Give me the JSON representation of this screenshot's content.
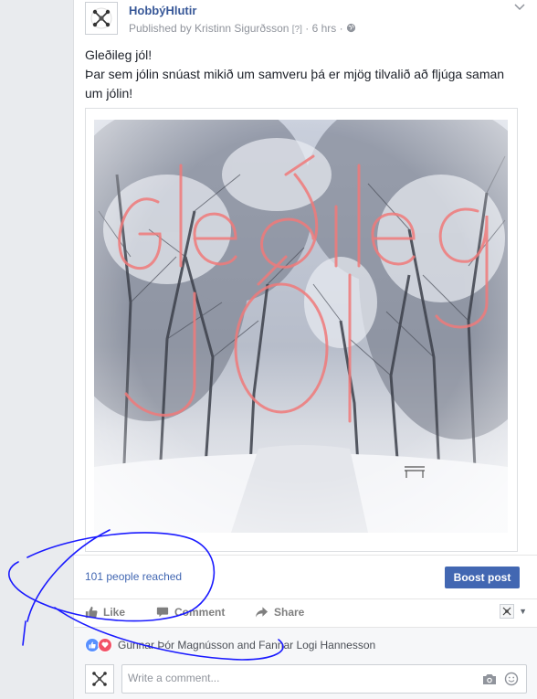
{
  "post": {
    "page_name": "HobbýHlutir",
    "published_by": "Published by Kristinn Sigurðsson",
    "help_mark": "[?]",
    "separator": "·",
    "time": "6 hrs",
    "separator2": "·",
    "text_lines": [
      "Gleðileg jól!",
      "Þar sem jólin snúast mikið um samveru þá er mjög tilvalið að fljúga saman",
      "um jólin!"
    ],
    "image_text": {
      "line1": "Gleðileg",
      "line2": "Jól"
    }
  },
  "stats": {
    "reach_count": "101",
    "reach_suffix": " people reached",
    "boost_label": "Boost post"
  },
  "actions": {
    "like": "Like",
    "comment": "Comment",
    "share": "Share"
  },
  "reactions": {
    "names": "Gunnar Þór Magnússon and Fannar Logi Hannesson"
  },
  "composer": {
    "placeholder": "Write a comment..."
  },
  "colors": {
    "link_blue": "#385898",
    "button_blue": "#4267b2",
    "annotation_blue": "#1a1aff",
    "overlay_text": "#f07a7a"
  }
}
